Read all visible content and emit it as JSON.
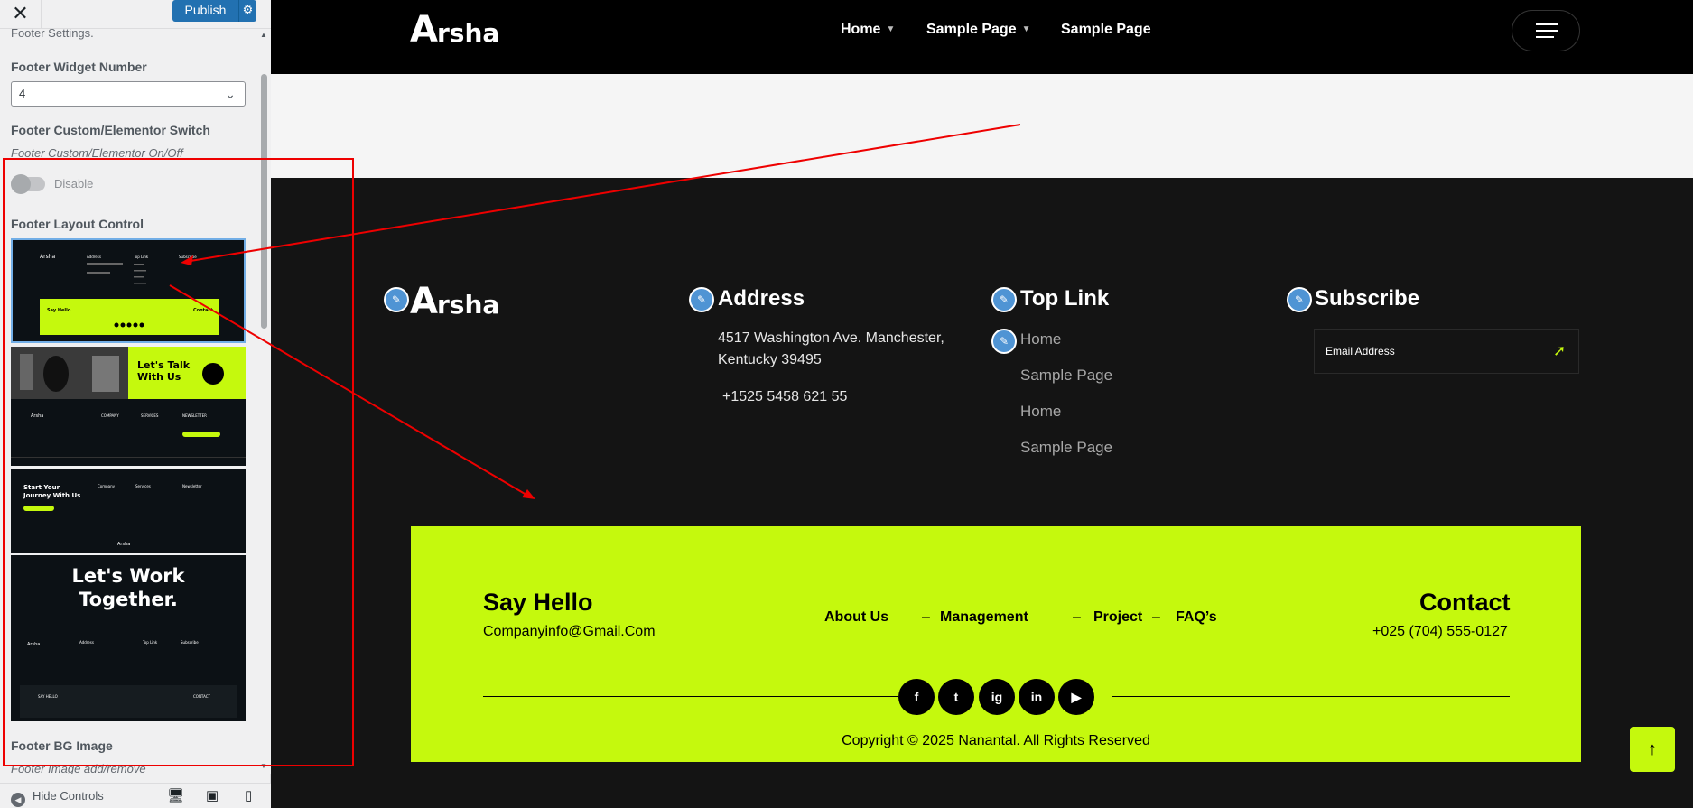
{
  "customizer": {
    "close_glyph": "✕",
    "publish_label": "Publish",
    "gear_glyph": "⚙",
    "footer_settings_desc": "Footer Settings.",
    "widget_number_label": "Footer Widget Number",
    "widget_number_value": "4",
    "switch_label": "Footer Custom/Elementor Switch",
    "switch_desc": "Footer Custom/Elementor On/Off",
    "toggle_label": "Disable",
    "layout_control_label": "Footer Layout Control",
    "bg_image_label": "Footer BG Image",
    "bg_image_desc": "Footer Image add/remove",
    "hide_controls_label": "Hide Controls",
    "thumbs": {
      "t1": {
        "logo": "Arsha",
        "address": "Address",
        "toplink": "Top Link",
        "subscribe": "Subscribe",
        "say_hello": "Say Hello",
        "contact": "Contact"
      },
      "t2": {
        "headline1": "Let's Talk",
        "headline2": "With Us",
        "logo": "Arsha",
        "company": "COMPANY",
        "services": "SERVICES",
        "newsletter": "NEWSLETTER"
      },
      "t3": {
        "headline1": "Start Your",
        "headline2": "Journey With Us",
        "company": "Company",
        "services": "Services",
        "newsletter": "Newsletter",
        "logo": "Arsha"
      },
      "t4": {
        "headline1": "Let's Work",
        "headline2": "Together.",
        "logo": "Arsha",
        "address": "Address",
        "toplink": "Top Link",
        "subscribe": "Subscribe",
        "say_hello": "SAY HELLO",
        "contact": "CONTACT"
      }
    }
  },
  "site": {
    "logo": "rsha",
    "logo_A": "A",
    "nav": [
      "Home",
      "Sample Page",
      "Sample Page"
    ],
    "footer": {
      "logo": "rsha",
      "logo_A": "A",
      "address_heading": "Address",
      "address_line1": "4517 Washington Ave. Manchester,",
      "address_line2": "Kentucky 39495",
      "phone": "+1525 5458 621 55",
      "toplink_heading": "Top Link",
      "toplinks": [
        "Home",
        "Sample Page",
        "Home",
        "Sample Page"
      ],
      "subscribe_heading": "Subscribe",
      "email_placeholder": "Email Address",
      "say_hello": "Say Hello",
      "company_email": "Companyinfo@Gmail.Com",
      "menu": [
        "About Us",
        "Management",
        "Project",
        "FAQ’s"
      ],
      "contact_heading": "Contact",
      "contact_phone": "+025 (704) 555-0127",
      "social": [
        "f",
        "t",
        "ig",
        "in",
        "▶"
      ],
      "copyright": "Copyright © 2025 Nanantal. All Rights Reserved"
    }
  },
  "colors": {
    "accent": "#c5f90d",
    "publish_blue": "#2271b1",
    "annotation_red": "#e00000"
  }
}
